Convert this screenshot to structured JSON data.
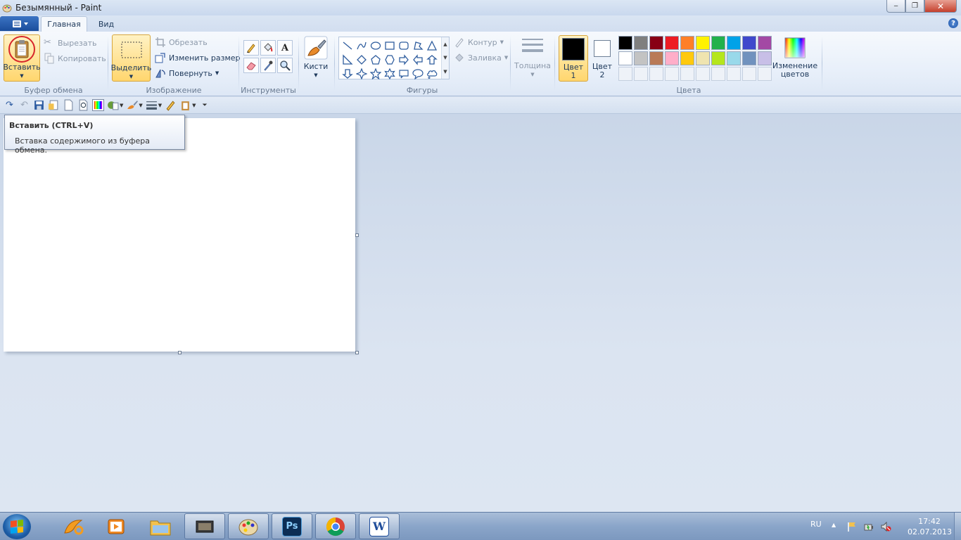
{
  "window": {
    "title": "Безымянный - Paint",
    "minimize": "‒",
    "maximize": "❐",
    "close": "✕"
  },
  "tabs": [
    {
      "label": "Главная"
    },
    {
      "label": "Вид"
    }
  ],
  "help": "?",
  "clipboard": {
    "paste": "Вставить",
    "cut": "Вырезать",
    "copy": "Копировать",
    "label": "Буфер обмена"
  },
  "image": {
    "select": "Выделить",
    "crop": "Обрезать",
    "resize": "Изменить размер",
    "rotate": "Повернуть",
    "label": "Изображение"
  },
  "tools": {
    "label": "Инструменты",
    "text_tool": "A"
  },
  "brushes": {
    "label": "Кисти"
  },
  "shapes": {
    "label": "Фигуры",
    "outline": "Контур",
    "fill": "Заливка"
  },
  "size": {
    "label": "Толщина"
  },
  "colors": {
    "color1_line1": "Цвет",
    "color1_line2": "1",
    "color2_line1": "Цвет",
    "color2_line2": "2",
    "edit_line1": "Изменение",
    "edit_line2": "цветов",
    "label": "Цвета",
    "color1_value": "#000000",
    "color2_value": "#ffffff",
    "palette_row1": [
      "#000000",
      "#7f7f7f",
      "#880015",
      "#ed1c24",
      "#ff7f27",
      "#fff200",
      "#22b14c",
      "#00a2e8",
      "#3f48cc",
      "#a349a4"
    ],
    "palette_row2": [
      "#ffffff",
      "#c3c3c3",
      "#b97a57",
      "#ffaec9",
      "#ffc90e",
      "#efe4b0",
      "#b5e61d",
      "#99d9ea",
      "#7092be",
      "#c8bfe7"
    ]
  },
  "tooltip": {
    "title": "Вставить (CTRL+V)",
    "text": "Вставка содержимого из буфера обмена."
  },
  "taskbar": {
    "lang": "RU",
    "time": "17:42",
    "date": "02.07.2013",
    "photoshop": "Ps",
    "word": "W"
  }
}
